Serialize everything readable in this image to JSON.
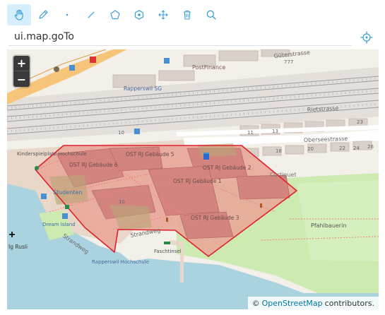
{
  "toolbar": {
    "tools": [
      {
        "name": "pan-tool",
        "icon": "hand-icon",
        "active": true
      },
      {
        "name": "draw-freehand-tool",
        "icon": "pencil-icon",
        "active": false
      },
      {
        "name": "draw-point-tool",
        "icon": "point-icon",
        "active": false
      },
      {
        "name": "draw-line-tool",
        "icon": "line-icon",
        "active": false
      },
      {
        "name": "draw-polygon-tool",
        "icon": "pentagon-icon",
        "active": false
      },
      {
        "name": "draw-polygon-node-tool",
        "icon": "hexagon-dot-icon",
        "active": false
      },
      {
        "name": "move-tool",
        "icon": "move-arrows-icon",
        "active": false
      },
      {
        "name": "delete-tool",
        "icon": "trash-icon",
        "active": false
      },
      {
        "name": "search-tool",
        "icon": "search-icon",
        "active": false
      }
    ],
    "accent": "#3aa0d8"
  },
  "search": {
    "value": "ui.map.goTo",
    "placeholder": ""
  },
  "locate_icon": "crosshair-icon",
  "map": {
    "zoom_in": "+",
    "zoom_out": "−",
    "attribution_prefix": "©",
    "attribution_link": "OpenStreetMap",
    "attribution_suffix": "contributors.",
    "polygon_color": "#e0202c",
    "labels": {
      "gueterstrasse": "Güterstrasse",
      "postfinance": "PostFinance",
      "rapperswil_sg": "Rapperswil SG",
      "rietstrasse": "Rietstrasse",
      "oberseestrasse": "Oberseestrasse",
      "kinderspielplatz": "Kinderspielplatz Hochschule",
      "studenten": "Studenten",
      "dream_island": "Dream Island",
      "ost6": "OST RJ Gebäude 6",
      "ost5": "OST RJ Gebäude 5",
      "ost2": "OST RJ Gebäude 2",
      "ost1": "OST RJ Gebäude 1",
      "ost3": "OST RJ Gebäude 3",
      "curtiguet": "Curtiguet",
      "pfahlbauerin": "Pfahlbauerin",
      "strandweg1": "Strandweg",
      "strandweg2": "Strandweg",
      "faschtinsel": "Faschtinsel",
      "rapperswil_hochschule": "Rapperswil Hochschule",
      "ig_rusli": "Ig Rusli",
      "n777": "777",
      "n10a": "10",
      "n10b": "10",
      "n18": "18",
      "n20": "20",
      "n22": "22",
      "n24": "24",
      "n26": "26",
      "n23": "23",
      "n11": "11",
      "n13": "13"
    }
  }
}
